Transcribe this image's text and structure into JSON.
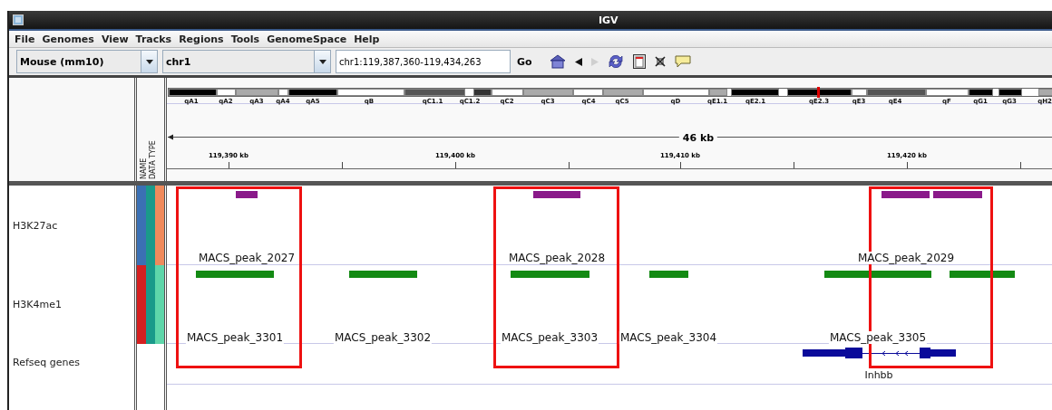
{
  "window": {
    "title": "IGV"
  },
  "menu": [
    "File",
    "Genomes",
    "View",
    "Tracks",
    "Regions",
    "Tools",
    "GenomeSpace",
    "Help"
  ],
  "toolbar": {
    "genome": "Mouse (mm10)",
    "chromosome": "chr1",
    "locus": "chr1:119,387,360-119,434,263",
    "go": "Go",
    "icons": [
      {
        "kind": "home",
        "disabled": false
      },
      {
        "kind": "back",
        "disabled": false
      },
      {
        "kind": "forward",
        "disabled": true
      },
      {
        "kind": "refresh",
        "disabled": false
      },
      {
        "kind": "region",
        "disabled": false
      },
      {
        "kind": "fit",
        "disabled": false
      },
      {
        "kind": "comment",
        "disabled": false
      }
    ]
  },
  "attribute_headers": [
    "NAME",
    "DATA TYPE"
  ],
  "ideogram": {
    "bands": [
      {
        "label": "qA1",
        "color": "#000000"
      },
      {
        "label": "qA2",
        "color": "#ffffff"
      },
      {
        "label": "qA3",
        "color": "#aaaaaa"
      },
      {
        "label": "qA4",
        "color": "#ffffff"
      },
      {
        "label": "qA5",
        "color": "#000000"
      },
      {
        "label": "qB",
        "color": "#ffffff"
      },
      {
        "label": "qC1.1",
        "color": "#555555"
      },
      {
        "label": "qC1.2",
        "color": "#333333"
      },
      {
        "label": "qC2",
        "color": "#ffffff"
      },
      {
        "label": "qC3",
        "color": "#aaaaaa"
      },
      {
        "label": "qC4",
        "color": "#ffffff"
      },
      {
        "label": "qC5",
        "color": "#aaaaaa"
      },
      {
        "label": "qD",
        "color": "#ffffff"
      },
      {
        "label": "qE1.1",
        "color": "#aaaaaa"
      },
      {
        "label": "qE2.1",
        "color": "#000000"
      },
      {
        "label": "qE2.3",
        "color": "#000000"
      },
      {
        "label": "qE3",
        "color": "#ffffff"
      },
      {
        "label": "qE4",
        "color": "#555555"
      },
      {
        "label": "qF",
        "color": "#ffffff"
      },
      {
        "label": "qG1",
        "color": "#000000"
      },
      {
        "label": "qG3",
        "color": "#000000"
      },
      {
        "label": "qH2",
        "color": "#aaaaaa"
      }
    ]
  },
  "ruler": {
    "span": "46 kb",
    "ticks": [
      "119,390 kb",
      "119,400 kb",
      "119,410 kb",
      "119,420 kb"
    ]
  },
  "tracks": [
    {
      "name": "H3K27ac",
      "attributes": [
        {
          "color": "#3b70b4"
        },
        {
          "color": "#1a9a8a"
        },
        {
          "color": "#f08a5c"
        }
      ],
      "labels": [
        "MACS_peak_2027",
        "MACS_peak_2028",
        "MACS_peak_2029"
      ]
    },
    {
      "name": "H3K4me1",
      "attributes": [
        {
          "color": "#d42020"
        },
        {
          "color": "#1a9a8a"
        },
        {
          "color": "#5fd6aa"
        }
      ],
      "labels": [
        "MACS_peak_3301",
        "MACS_peak_3302",
        "MACS_peak_3303",
        "MACS_peak_3304",
        "MACS_peak_3305"
      ]
    },
    {
      "name": "Refseq genes",
      "labels": [
        "Inhbb"
      ]
    }
  ]
}
